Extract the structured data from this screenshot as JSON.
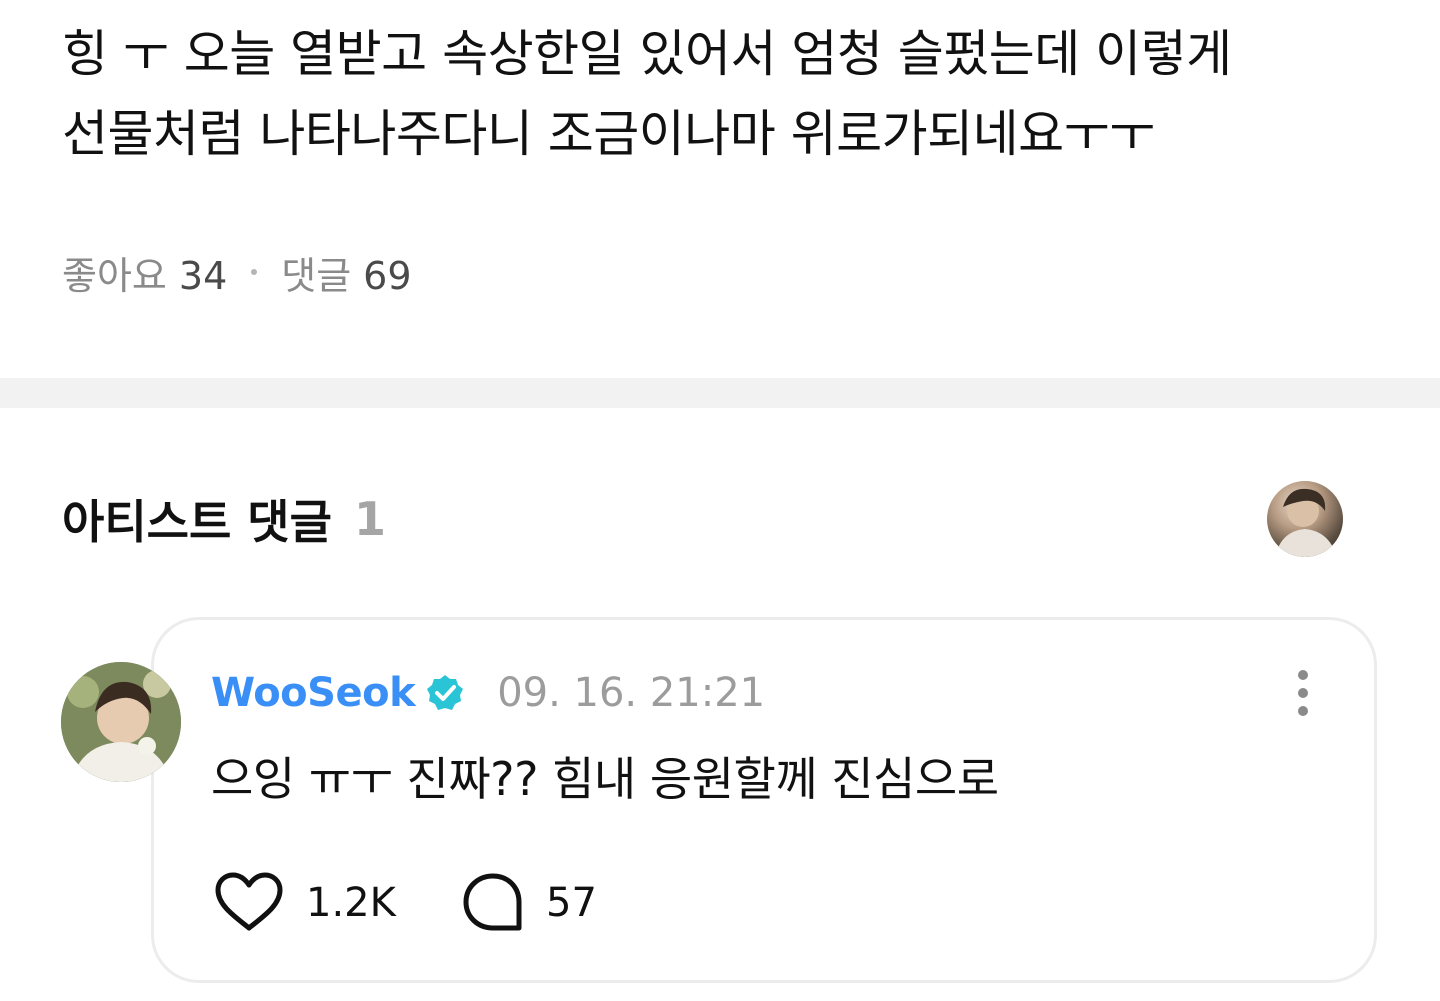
{
  "post": {
    "lines": [
      "힝 ㅜ 오늘  열받고 속상한일 있어서 엄청 슬펐는데 이렇게",
      "선물처럼 나타나주다니 조금이나마 위로가되네요ㅜㅜ"
    ],
    "likes_label": "좋아요",
    "likes_count": "34",
    "comments_label": "댓글",
    "comments_count": "69"
  },
  "artist_section": {
    "title": "아티스트 댓글",
    "count": "1",
    "avatar_icon": "artist-avatar"
  },
  "comment": {
    "author": "WooSeok",
    "verified_icon": "verified-badge-icon",
    "time": "09. 16. 21:21",
    "text": "으잉 ㅠㅜ 진짜?? 힘내 응원할께 진심으로",
    "like_count": "1.2K",
    "reply_count": "57",
    "more_icon": "more-vertical-icon"
  },
  "colors": {
    "author": "#3a8ff7",
    "badge": "#29c4d6",
    "muted": "#9c9c9c",
    "divider": "#f2f2f2"
  }
}
